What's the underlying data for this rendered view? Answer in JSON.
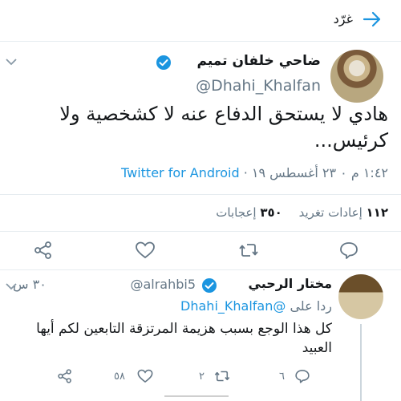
{
  "header": {
    "title": "غرّد",
    "back_icon": "arrow-right-icon"
  },
  "tweet": {
    "author_name": "ضاحي خلفان تميم",
    "author_handle": "@Dhahi_Khalfan",
    "text": "هادي لا يستحق الدفاع عنه لا كشخصية ولا كرئيس...",
    "timestamp": "١:٤٢ م ٣٠ ٢٣ أغسطس ١٩",
    "timestamp_display": "١:٤٢ م ٠ ٢٣ أغسطس ١٩",
    "source": "Twitter for Android",
    "retweets_count": "١١٢",
    "retweets_label": "إعادات تغريد",
    "likes_count": "٣٥٠",
    "likes_label": "إعجابات"
  },
  "reply": {
    "author_name": "مختار الرحبي",
    "author_handle": "@alrahbi5",
    "time": "٣٠ س",
    "reply_to_label": "ردا على",
    "reply_to_handle": "@Dhahi_Khalfan",
    "text": "كل هذا الوجع بسبب هزيمة المرتزقة التابعين لكم أيها العبيد",
    "replies_count": "٦",
    "retweets_count": "٢",
    "likes_count": "٥٨"
  },
  "colors": {
    "accent": "#1b95e0",
    "text": "#14171a",
    "muted": "#657786",
    "divider": "#e6ecf0"
  }
}
